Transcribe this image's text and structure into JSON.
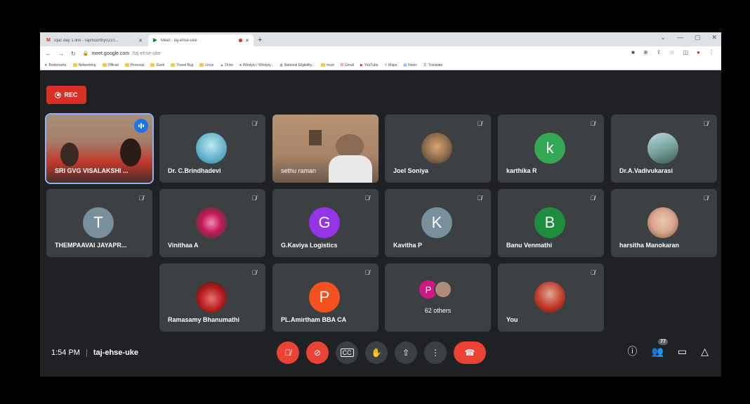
{
  "browser": {
    "tabs": [
      {
        "title": "Iqac day 1 link - rajimoorthy0210...",
        "icon": "gmail-icon",
        "active": false
      },
      {
        "title": "Meet - taj-ehse-uke",
        "icon": "meet-icon",
        "active": true
      }
    ],
    "new_tab": "+",
    "url_host": "meet.google.com",
    "url_path": "/taj-ehse-uke",
    "bookmarks": [
      {
        "label": "Bookmarks",
        "type": "star"
      },
      {
        "label": "Networking",
        "type": "folder"
      },
      {
        "label": "Official",
        "type": "folder"
      },
      {
        "label": "Personal",
        "type": "folder"
      },
      {
        "label": "Geek",
        "type": "folder"
      },
      {
        "label": "Travel Bug",
        "type": "folder"
      },
      {
        "label": "Linux",
        "type": "folder"
      },
      {
        "label": "Drive",
        "type": "site"
      },
      {
        "label": "Windytv / Windyty...",
        "type": "site"
      },
      {
        "label": "National Eligibility...",
        "type": "site"
      },
      {
        "label": "muvt",
        "type": "folder"
      },
      {
        "label": "Gmail",
        "type": "site"
      },
      {
        "label": "YouTube",
        "type": "site"
      },
      {
        "label": "Maps",
        "type": "site"
      },
      {
        "label": "News",
        "type": "site"
      },
      {
        "label": "Translate",
        "type": "site"
      }
    ]
  },
  "recording": {
    "label": "REC"
  },
  "participants": [
    {
      "name": "SRI GVG VISALAKSHI ...",
      "kind": "video",
      "speaking": true
    },
    {
      "name": "Dr. C.Brindhadevi",
      "kind": "photo",
      "color": "#5fb0c8",
      "muted": true
    },
    {
      "name": "sethu raman",
      "kind": "video",
      "muted": false
    },
    {
      "name": "Joel Soniya",
      "kind": "photo",
      "color": "#8a6a4a",
      "muted": true
    },
    {
      "name": "karthika R",
      "kind": "letter",
      "letter": "k",
      "color": "#34a853",
      "muted": true
    },
    {
      "name": "Dr.A.Vadivukarasi",
      "kind": "photo",
      "color": "#7aa6a0",
      "muted": true
    },
    {
      "name": "THEMPAAVAI JAYAPR...",
      "kind": "letter",
      "letter": "T",
      "color": "#78909c",
      "muted": true
    },
    {
      "name": "Vinithaa A",
      "kind": "photo",
      "color": "#c2185b",
      "muted": true
    },
    {
      "name": "G.Kaviya Logistics",
      "kind": "letter",
      "letter": "G",
      "color": "#9334e6",
      "muted": true
    },
    {
      "name": "Kavitha P",
      "kind": "letter",
      "letter": "K",
      "color": "#78909c",
      "muted": true
    },
    {
      "name": "Banu Venmathi",
      "kind": "letter",
      "letter": "B",
      "color": "#1e8e3e",
      "muted": true
    },
    {
      "name": "harsitha Manokaran",
      "kind": "photo",
      "color": "#d9a48c",
      "muted": true
    },
    {
      "name": "Ramasamy Bhanumathi",
      "kind": "photo",
      "color": "#b71c1c",
      "muted": true
    },
    {
      "name": "PL.Amirtham BBA CA",
      "kind": "letter",
      "letter": "P",
      "color": "#f4511e",
      "muted": true
    },
    {
      "name": "You",
      "kind": "photo",
      "color": "#c0392b",
      "muted": true
    }
  ],
  "others_tile": {
    "letter": "P",
    "count_label": "62 others"
  },
  "meeting": {
    "time": "1:54 PM",
    "separator": "|",
    "code": "taj-ehse-uke"
  },
  "controls": [
    "mic-off-icon",
    "camera-off-icon",
    "captions-icon",
    "raise-hand-icon",
    "present-icon",
    "more-options-icon",
    "end-call-icon"
  ],
  "right_controls": {
    "people_count": "77"
  }
}
